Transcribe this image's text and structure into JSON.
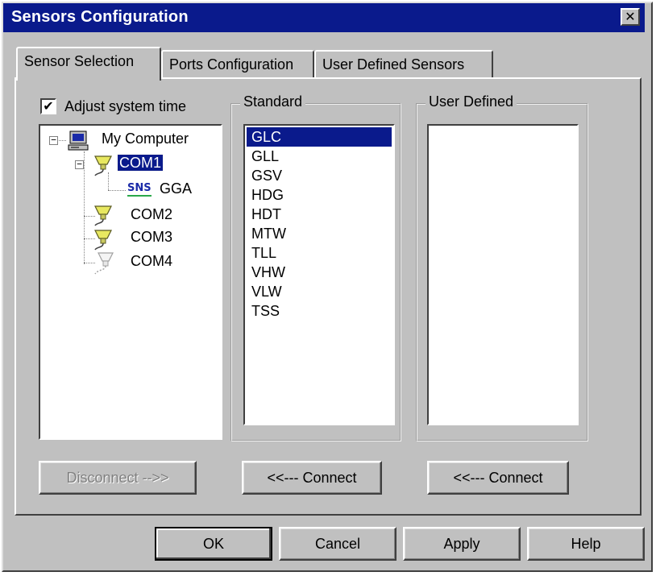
{
  "window": {
    "title": "Sensors Configuration",
    "close_glyph": "✕"
  },
  "tabs": [
    {
      "label": "Sensor Selection",
      "active": true
    },
    {
      "label": "Ports Configuration",
      "active": false
    },
    {
      "label": "User Defined Sensors",
      "active": false
    }
  ],
  "adjust_time": {
    "label": "Adjust system time",
    "checked": true,
    "check_glyph": "✔"
  },
  "tree": {
    "root": "My Computer",
    "ports": [
      "COM1",
      "COM2",
      "COM3",
      "COM4"
    ],
    "selected": "COM1",
    "com1_child": {
      "badge": "SNS",
      "label": "GGA"
    }
  },
  "standard": {
    "label": "Standard",
    "items": [
      "GLC",
      "GLL",
      "GSV",
      "HDG",
      "HDT",
      "MTW",
      "TLL",
      "VHW",
      "VLW",
      "TSS"
    ],
    "selected": "GLC"
  },
  "user_defined": {
    "label": "User Defined",
    "items": []
  },
  "buttons": {
    "disconnect": "Disconnect -->>",
    "connect_standard": "<<--- Connect",
    "connect_user": "<<--- Connect",
    "ok": "OK",
    "cancel": "Cancel",
    "apply": "Apply",
    "help": "Help"
  },
  "colors": {
    "titlebar": "#0a1a8c",
    "face": "#c0c0c0",
    "selection": "#0a1a8c"
  }
}
